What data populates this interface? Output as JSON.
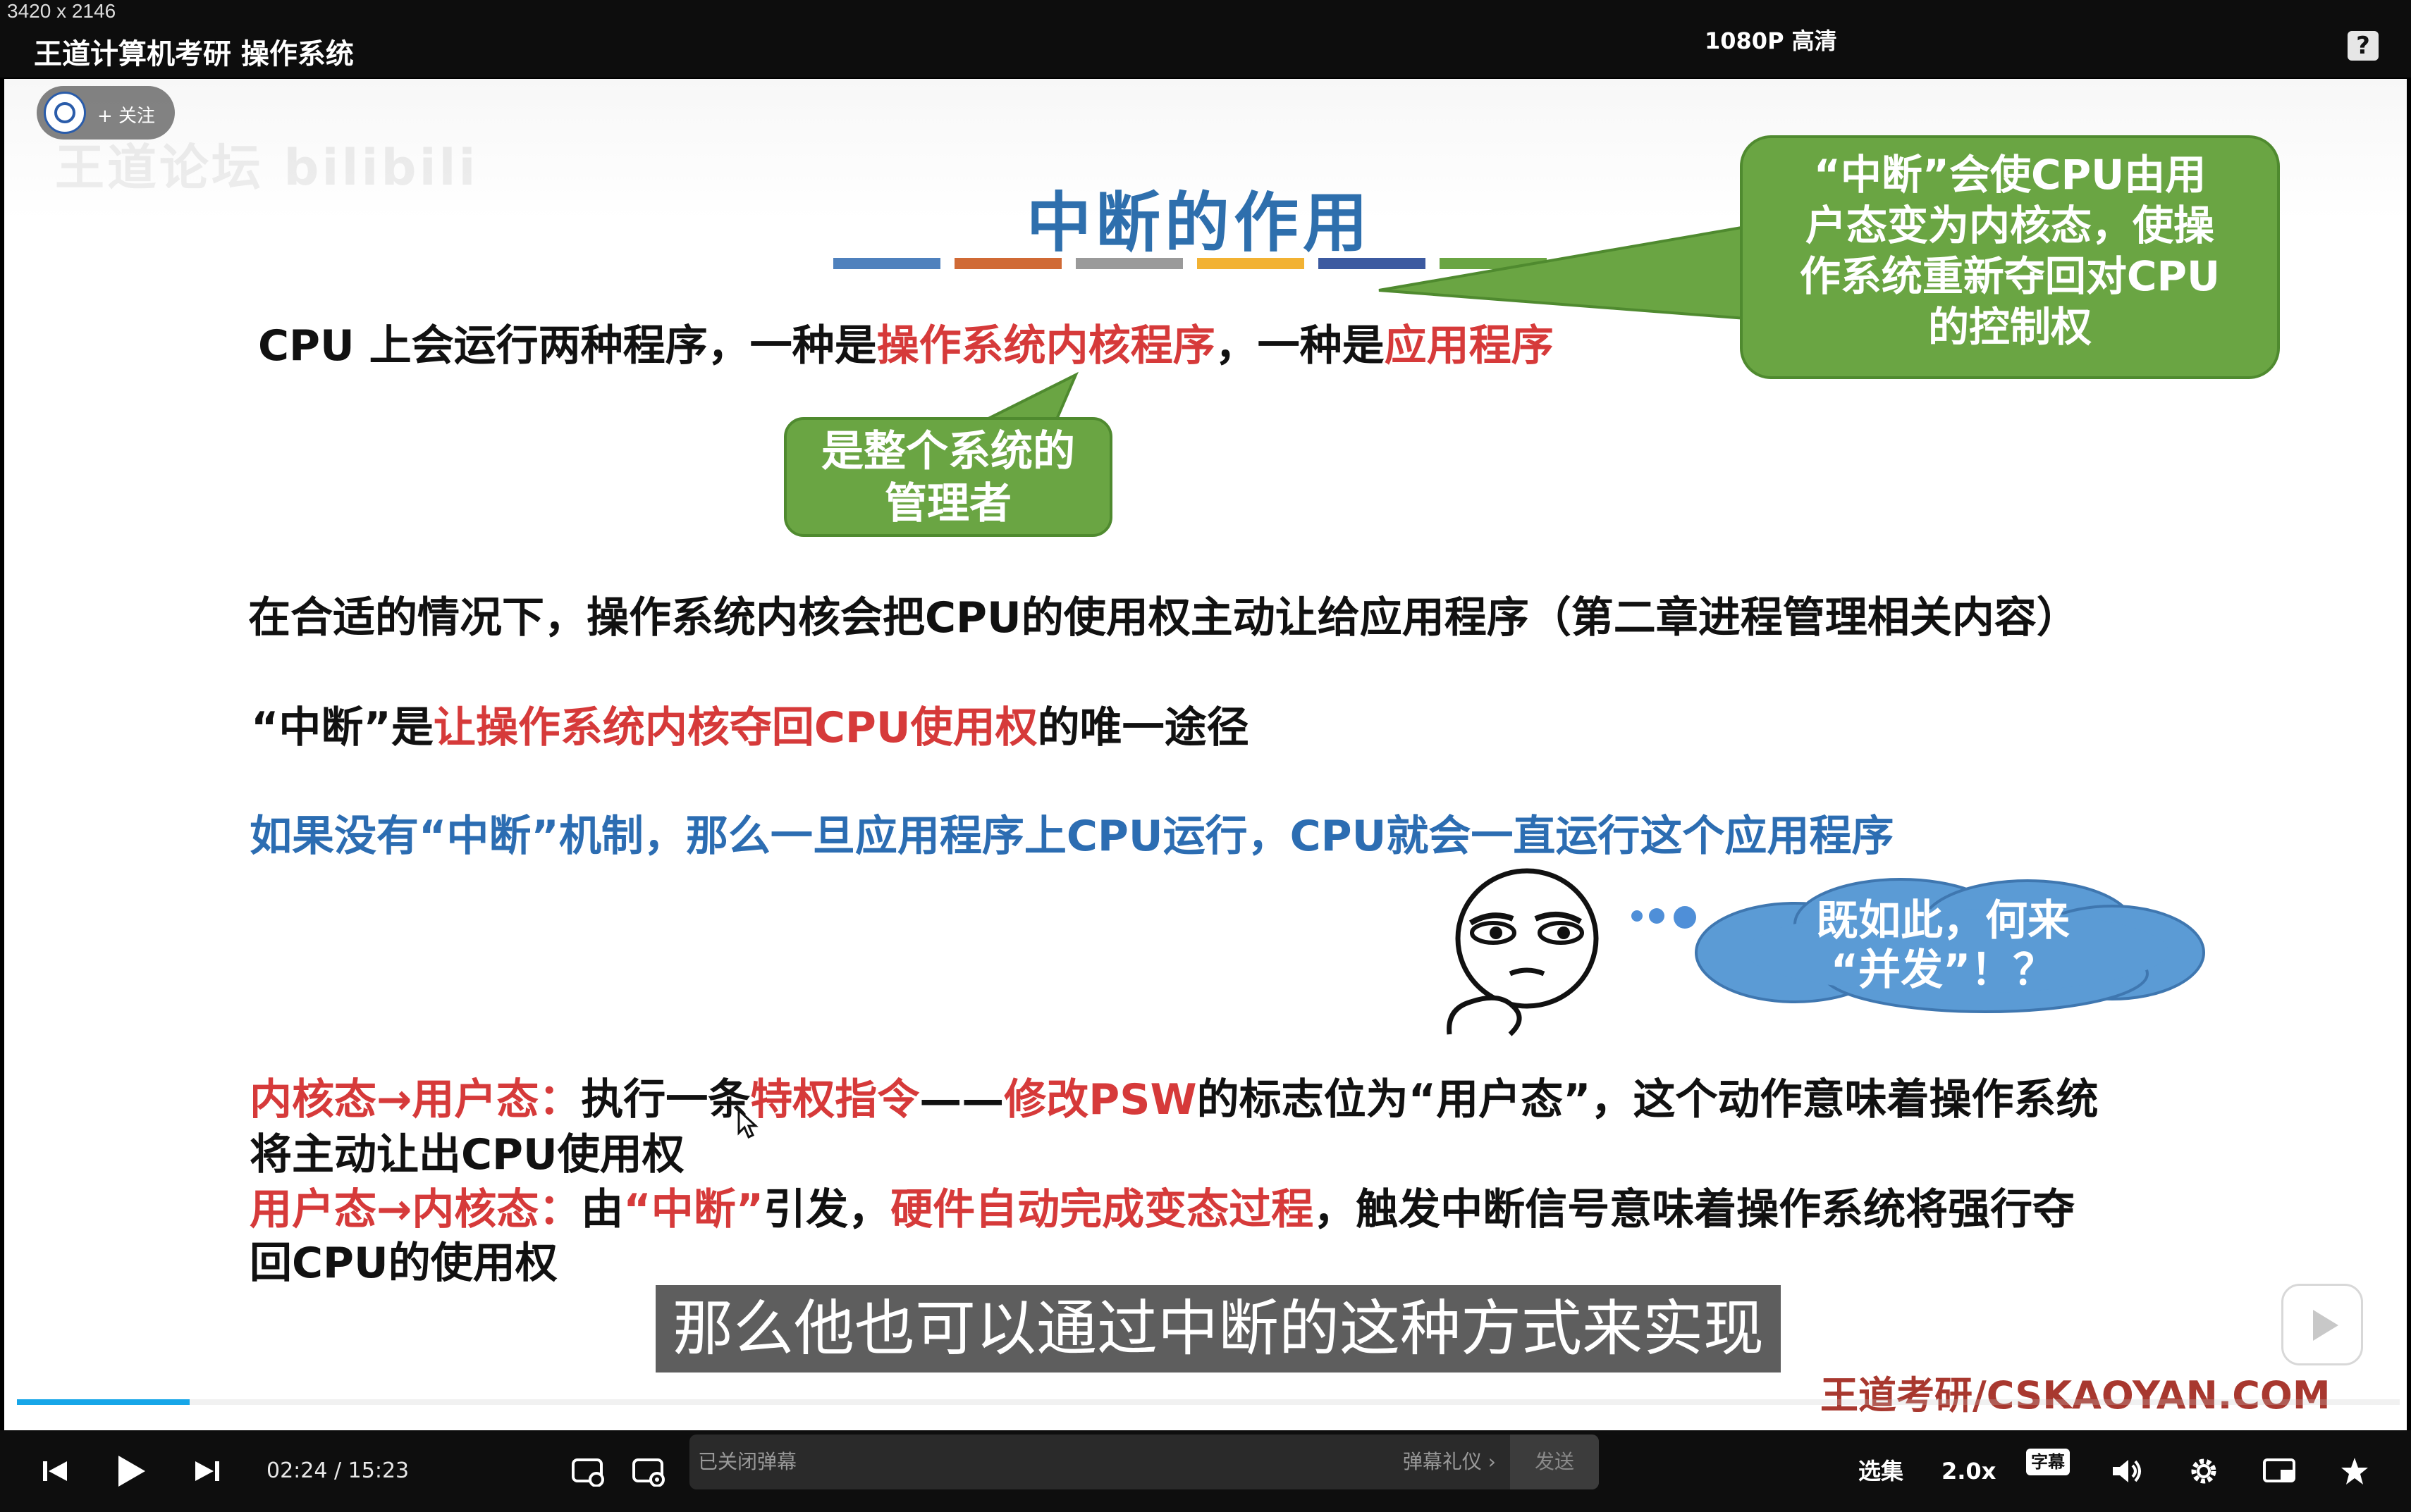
{
  "window": {
    "dims": "3420 x 2146",
    "title": "王道计算机考研 操作系统"
  },
  "uploader": {
    "follow_label": "+ 关注"
  },
  "watermark": "王道论坛 bilibili",
  "slide": {
    "title": "中断的作用",
    "title_bar_colors": [
      "#4f81bd",
      "#d06a35",
      "#9a9a9a",
      "#f2b233",
      "#3c5aa0",
      "#6aa543"
    ],
    "callout_right": [
      "“中断”会使CPU由用",
      "户态变为内核态，使操",
      "作系统重新夺回对CPU",
      "的控制权"
    ],
    "line1": {
      "a": "CPU 上会运行两种程序，一种是",
      "b": "操作系统内核程序",
      "c": "，一种是",
      "d": "应用程序"
    },
    "callout_small": [
      "是整个系统的",
      "管理者"
    ],
    "line2": "在合适的情况下，操作系统内核会把CPU的使用权主动让给应用程序（第二章进程管理相关内容）",
    "line3": {
      "a": "“中断”是",
      "b": "让操作系统内核夺回CPU使用权",
      "c": "的唯一途径"
    },
    "line4": "如果没有“中断”机制，那么一旦应用程序上CPU运行，CPU就会一直运行这个应用程序",
    "cloud": [
      "既如此，何来",
      "“并发”！？"
    ],
    "line5": {
      "a": "内核态→用户态：",
      "b": "执行一条",
      "c": "特权指令",
      "d": "——",
      "e": "修改PSW",
      "f": "的标志位为“用户态”，这个动作意味着操作系统"
    },
    "line6": "将主动让出CPU使用权",
    "line7": {
      "a": "用户态→内核态：",
      "b": "由",
      "c": "“中断”",
      "d": "引发，",
      "e": "硬件自动完成变态过程",
      "f": "，触发中断信号意味着操作系统将强行夺"
    },
    "line8": "回CPU的使用权",
    "brand": "王道考研/CSKAOYAN.COM"
  },
  "subtitle": "那么他也可以通过中断的这种方式来实现",
  "player": {
    "progress_fraction": 0.0725,
    "current_time": "02:24",
    "time_separator": "/",
    "duration": "15:23",
    "danmaku_placeholder": "已关闭弹幕",
    "danmaku_gift": "弹幕礼仪 ›",
    "send_label": "发送",
    "quality": "1080P 高清",
    "episodes": "选集",
    "speed": "2.0x",
    "cc_label": "字幕"
  },
  "colors": {
    "red": "#d63a3a",
    "blue": "#2c6db2",
    "green": "#6aa543",
    "progress": "#17a6e8"
  }
}
